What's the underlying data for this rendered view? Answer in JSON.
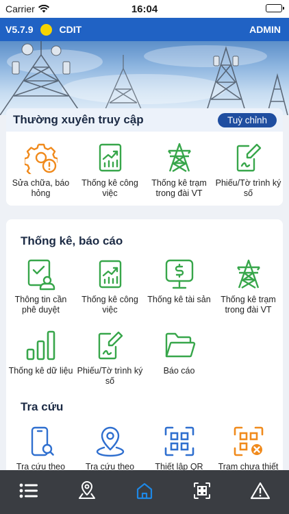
{
  "status_bar": {
    "carrier": "Carrier",
    "time": "16:04"
  },
  "header": {
    "version": "V5.7.9",
    "org": "CDIT",
    "user": "ADMIN"
  },
  "quick_access": {
    "title": "Thường xuyên truy cập",
    "customize_label": "Tuỳ chỉnh",
    "items": [
      {
        "label": "Sửa chữa, báo hỏng",
        "icon": "gear-warning-icon"
      },
      {
        "label": "Thống kê công việc",
        "icon": "chart-up-icon"
      },
      {
        "label": "Thống kê trạm trong đài VT",
        "icon": "tower-icon"
      },
      {
        "label": "Phiếu/Tờ trình ký số",
        "icon": "sign-document-icon"
      }
    ]
  },
  "reports": {
    "title": "Thống kê, báo cáo",
    "items": [
      {
        "label": "Thông tin cần phê duyệt",
        "icon": "approval-user-icon"
      },
      {
        "label": "Thống kê công việc",
        "icon": "chart-up-icon"
      },
      {
        "label": "Thống kê tài sản",
        "icon": "asset-monitor-icon"
      },
      {
        "label": "Thống kê trạm trong đài VT",
        "icon": "tower-icon"
      },
      {
        "label": "Thống kê dữ liệu",
        "icon": "bar-chart-icon"
      },
      {
        "label": "Phiếu/Tờ trình ký số",
        "icon": "sign-document-icon"
      },
      {
        "label": "Báo cáo",
        "icon": "folder-icon"
      }
    ]
  },
  "lookup": {
    "title": "Tra cứu",
    "items": [
      {
        "label": "Tra cứu theo",
        "icon": "phone-search-icon"
      },
      {
        "label": "Tra cứu theo",
        "icon": "location-pin-icon"
      },
      {
        "label": "Thiết lập QR",
        "icon": "qr-scan-icon"
      },
      {
        "label": "Trạm chưa thiết",
        "icon": "qr-cancel-icon"
      }
    ]
  },
  "bottom_nav": {
    "items": [
      "list-icon",
      "map-pin-icon",
      "home-icon",
      "qr-scan-icon",
      "warning-icon"
    ],
    "active": "home-icon",
    "colors": {
      "active": "#1e88e5",
      "inactive": "#ffffff"
    }
  },
  "colors": {
    "header": "#2062c4",
    "brand_dark": "#1f4ea0",
    "icon_green": "#37a64a",
    "icon_orange": "#f08a1c",
    "icon_blue": "#2f6fcf"
  }
}
